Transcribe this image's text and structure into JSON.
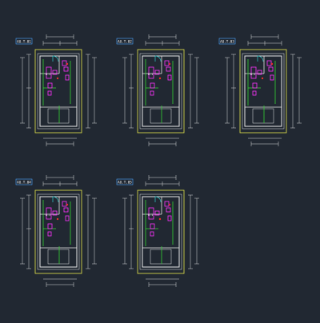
{
  "colors": {
    "background": "#212832",
    "wall": "#e8e8e8",
    "partition": "#33d133",
    "fixture": "#ff33ff",
    "outline": "#e6e64c",
    "dimension": "#d8d8d8",
    "door": "#33cccc",
    "tag_box": "#4da6ff",
    "marker": "#e62e2e"
  },
  "units": [
    {
      "tag": "AU.T.01",
      "room_label": "B.1"
    },
    {
      "tag": "AU.T.02",
      "room_label": "B.1"
    },
    {
      "tag": "AU.T.03",
      "room_label": "B.1"
    },
    {
      "tag": "AU.T.04",
      "room_label": "B.1"
    },
    {
      "tag": "AU.T.05",
      "room_label": "B.1"
    }
  ]
}
